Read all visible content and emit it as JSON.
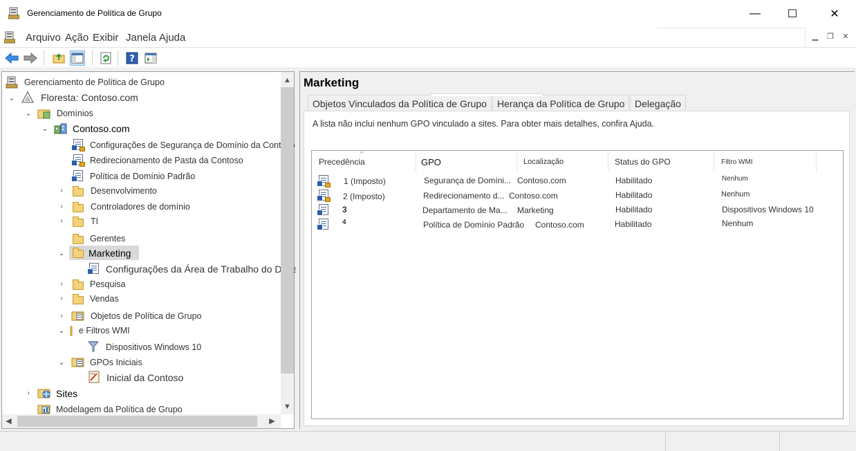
{
  "window": {
    "title": "Gerenciamento de Política de Grupo",
    "minimize": "—",
    "maximize": "☐",
    "close": "✕"
  },
  "menu": {
    "items": [
      "Arquivo",
      "Ação",
      "Exibir",
      "Janela",
      "Ajuda"
    ]
  },
  "tree": {
    "root": "Gerenciamento de Política de Grupo",
    "forest": "Floresta: Contoso.com",
    "domains": "Domínios",
    "domain": "Contoso.com",
    "domain_children": [
      "Configurações de Segurança de Domínio da Contoso",
      "Redirecionamento de Pasta da Contoso",
      "Política de Domínio Padrão",
      "Desenvolvimento",
      "Controladores de domínio",
      "TI",
      "Gerentes",
      "Marketing",
      "Configurações da Área de Trabalho do Departamento de Marketing",
      "Pesquisa",
      "Vendas",
      "Objetos de Política de Grupo",
      "e Filtros WMI",
      "Dispositivos Windows 10",
      "GPOs Iniciais",
      "Inicial da Contoso"
    ],
    "sites": "Sites",
    "modeling": "Modelagem da Política de Grupo"
  },
  "right": {
    "title": "Marketing",
    "tabs": [
      "Objetos Vinculados da Política de Grupo",
      "Herança da Política de Grupo",
      "Delegação"
    ],
    "info": "A lista não inclui nenhum GPO vinculado a sites. Para obter mais detalhes, confira Ajuda.",
    "columns": [
      "Precedência",
      "GPO",
      "Localização",
      "Status do GPO",
      "Filtro WMI"
    ],
    "rows": [
      {
        "prec": "1 (Imposto)",
        "gpo": "Segurança de Domíni...",
        "loc": "Contoso.com",
        "status": "Habilitado",
        "wmi": "Nenhum"
      },
      {
        "prec": "2 (Imposto)",
        "gpo": "Redirecionamento d...",
        "loc": "Contoso.com",
        "status": "Habilitado",
        "wmi": "Nenhum"
      },
      {
        "prec": "3",
        "gpo": "Departamento de Ma...",
        "loc": "Marketing",
        "status": "Habilitado",
        "wmi": "Dispositivos Windows 10"
      },
      {
        "prec": "4",
        "gpo": "Política de Domínio Padrão",
        "loc": "Contoso.com",
        "status": "Habilitado",
        "wmi": "Nenhum"
      }
    ]
  }
}
